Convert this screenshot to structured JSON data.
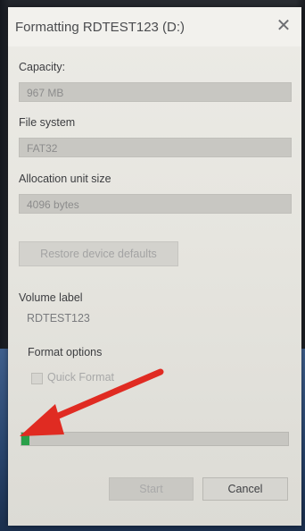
{
  "window": {
    "title": "Formatting RDTEST123 (D:)",
    "close_label": "✕"
  },
  "capacity": {
    "label": "Capacity:",
    "value": "967 MB"
  },
  "file_system": {
    "label": "File system",
    "value": "FAT32"
  },
  "allocation": {
    "label": "Allocation unit size",
    "value": "4096 bytes"
  },
  "restore_button": {
    "label": "Restore device defaults"
  },
  "volume": {
    "label": "Volume label",
    "value": "RDTEST123"
  },
  "format_options": {
    "label": "Format options",
    "quick_format_label": "Quick Format",
    "quick_format_checked": false
  },
  "progress": {
    "fraction": 0.01
  },
  "buttons": {
    "start": "Start",
    "cancel": "Cancel"
  },
  "annotation": {
    "arrow_color": "#e02b22"
  }
}
